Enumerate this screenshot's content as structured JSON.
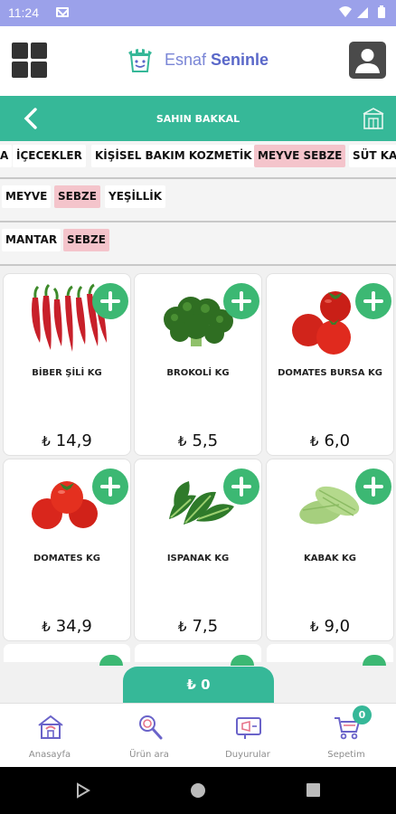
{
  "status_bar": {
    "time": "11:24"
  },
  "header": {
    "logo_text_light": "Esnaf ",
    "logo_text_bold": "Seninle",
    "menu_icon": "grid-icon",
    "profile_icon": "user-icon"
  },
  "store_bar": {
    "title": "SAHIN BAKKAL",
    "back_icon": "chevron-left-icon",
    "store_icon": "store-icon"
  },
  "categories": [
    "İÇECEKLER",
    "KİŞİSEL BAKIM KOZMETİK",
    "MEYVE SEBZE",
    "SÜT KA"
  ],
  "categories_left_partial": "A",
  "selected_category": "MEYVE SEBZE",
  "subcategories": [
    "MEYVE",
    "SEBZE",
    "YEŞİLLİK"
  ],
  "selected_subcategory": "SEBZE",
  "filters": [
    "MANTAR",
    "SEBZE"
  ],
  "selected_filter": "SEBZE",
  "products": [
    {
      "name": "BİBER ŞİLİ KG",
      "price": "14,9",
      "currency": "₺"
    },
    {
      "name": "BROKOLİ KG",
      "price": "5,5",
      "currency": "₺"
    },
    {
      "name": "DOMATES BURSA KG",
      "price": "6,0",
      "currency": "₺"
    },
    {
      "name": "DOMATES KG",
      "price": "34,9",
      "currency": "₺"
    },
    {
      "name": "ISPANAK KG",
      "price": "7,5",
      "currency": "₺"
    },
    {
      "name": "KABAK KG",
      "price": "9,0",
      "currency": "₺"
    }
  ],
  "cart": {
    "total": "₺ 0",
    "count": "0"
  },
  "bottom_nav": [
    {
      "label": "Anasayfa",
      "icon": "home-icon"
    },
    {
      "label": "Ürün ara",
      "icon": "search-icon"
    },
    {
      "label": "Duyurular",
      "icon": "announcement-icon"
    },
    {
      "label": "Sepetim",
      "icon": "cart-icon"
    }
  ],
  "colors": {
    "status_bar": "#9ba1ea",
    "accent": "#36b898",
    "add_button": "#3cb873",
    "selected_chip": "#f4c4cb",
    "brand": "#5a68c9"
  }
}
